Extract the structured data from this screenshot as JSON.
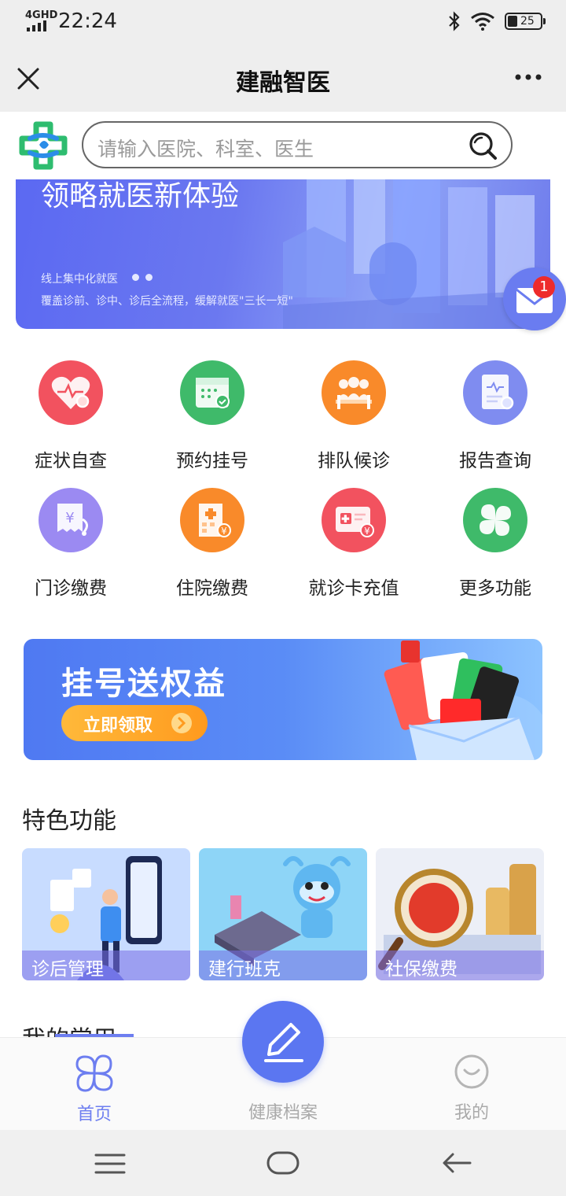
{
  "status_bar": {
    "network": "4GHD",
    "time": "22:24",
    "battery": "25"
  },
  "header": {
    "title": "建融智医"
  },
  "search": {
    "placeholder": "请输入医院、科室、医生"
  },
  "banner": {
    "title": "领略就医新体验",
    "subtitle": "线上集中化就医",
    "description": "覆盖诊前、诊中、诊后全流程，缓解就医\"三长一短\""
  },
  "mail": {
    "badge_count": "1"
  },
  "features": [
    {
      "label": "症状自查",
      "icon": "heart-search-icon",
      "color": "#f2525f"
    },
    {
      "label": "预约挂号",
      "icon": "calendar-check-icon",
      "color": "#3fba6a"
    },
    {
      "label": "排队候诊",
      "icon": "queue-icon",
      "color": "#f98a2a"
    },
    {
      "label": "报告查询",
      "icon": "report-search-icon",
      "color": "#7f8cf0"
    },
    {
      "label": "门诊缴费",
      "icon": "outpatient-payment-icon",
      "color": "#9b8af2"
    },
    {
      "label": "住院缴费",
      "icon": "hospital-payment-icon",
      "color": "#f98a2a"
    },
    {
      "label": "就诊卡充值",
      "icon": "medical-card-recharge-icon",
      "color": "#f2525f"
    },
    {
      "label": "更多功能",
      "icon": "clover-icon",
      "color": "#3fba6a"
    }
  ],
  "promo": {
    "title": "挂号送权益",
    "button": "立即领取"
  },
  "special": {
    "title": "特色功能",
    "cards": [
      {
        "label": "诊后管理"
      },
      {
        "label": "建行班克"
      },
      {
        "label": "社保缴费"
      }
    ]
  },
  "frequent": {
    "title": "我的常用"
  },
  "tabs": [
    {
      "label": "首页",
      "icon": "home-grid-icon"
    },
    {
      "label": "健康档案",
      "icon": "edit-icon"
    },
    {
      "label": "我的",
      "icon": "smile-icon"
    }
  ]
}
